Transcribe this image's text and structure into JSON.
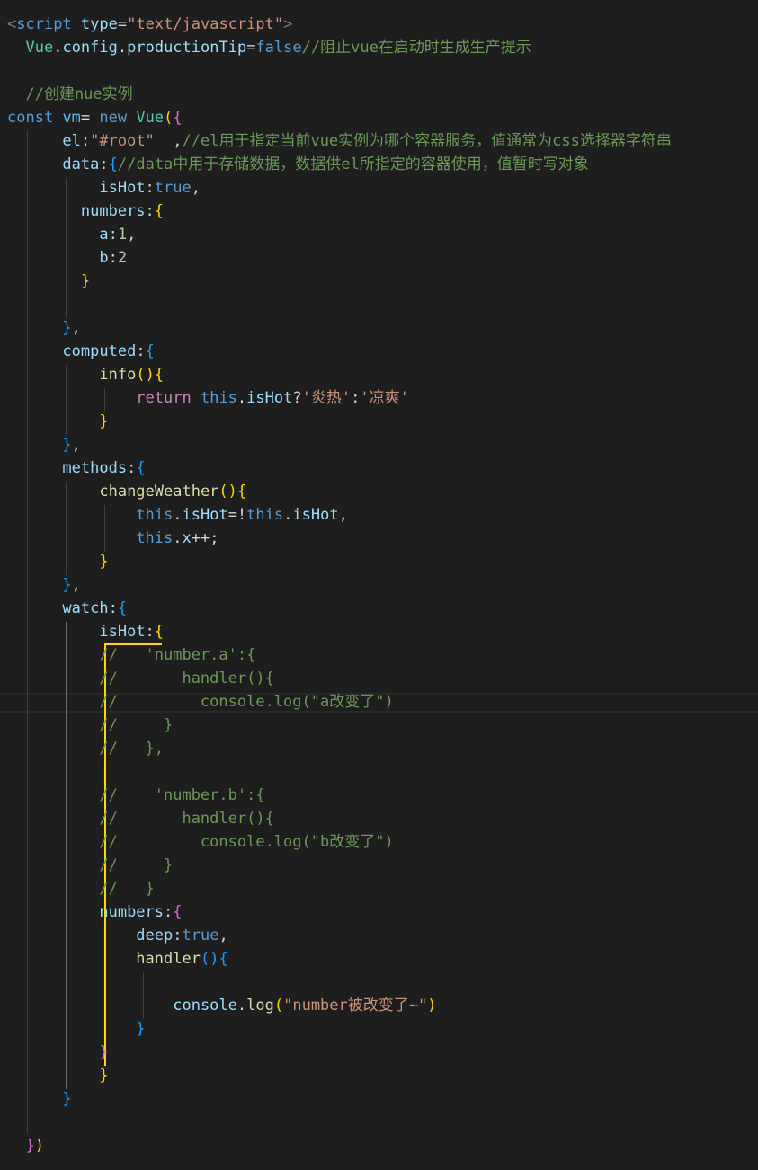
{
  "editor": {
    "language": "html-vue",
    "theme": "dark",
    "background": "#1e1e1e",
    "colors": {
      "default": "#d4d4d4",
      "tag_punct": "#808080",
      "tag": "#569cd6",
      "attr": "#9cdcfe",
      "string": "#ce9178",
      "comment": "#6a9955",
      "keyword": "#569cd6",
      "control": "#c586c0",
      "class": "#4ec9b0",
      "function": "#dcdcaa",
      "variable": "#9cdcfe",
      "const": "#4fc1ff",
      "number": "#b5cea8",
      "bracket1": "#ffd700",
      "bracket2": "#da70d6",
      "bracket3": "#179fff"
    },
    "lines": [
      {
        "tokens": [
          {
            "t": "<",
            "c": "tag_punct"
          },
          {
            "t": "script",
            "c": "tag"
          },
          {
            "t": " ",
            "c": "default"
          },
          {
            "t": "type",
            "c": "attr"
          },
          {
            "t": "=",
            "c": "default"
          },
          {
            "t": "\"text/javascript\"",
            "c": "string"
          },
          {
            "t": ">",
            "c": "tag_punct"
          }
        ]
      },
      {
        "tokens": [
          {
            "t": "  ",
            "c": "default"
          },
          {
            "t": "Vue",
            "c": "class"
          },
          {
            "t": ".",
            "c": "default"
          },
          {
            "t": "config",
            "c": "variable"
          },
          {
            "t": ".",
            "c": "default"
          },
          {
            "t": "productionTip",
            "c": "variable"
          },
          {
            "t": "=",
            "c": "default"
          },
          {
            "t": "false",
            "c": "keyword"
          },
          {
            "t": "//阻止vue在启动时生成生产提示",
            "c": "comment"
          }
        ]
      },
      {
        "tokens": []
      },
      {
        "tokens": [
          {
            "t": "  //创建nue实例",
            "c": "comment"
          }
        ]
      },
      {
        "tokens": [
          {
            "t": "const",
            "c": "keyword"
          },
          {
            "t": " ",
            "c": "default"
          },
          {
            "t": "vm",
            "c": "const"
          },
          {
            "t": "= ",
            "c": "default"
          },
          {
            "t": "new",
            "c": "keyword"
          },
          {
            "t": " ",
            "c": "default"
          },
          {
            "t": "Vue",
            "c": "class"
          },
          {
            "t": "(",
            "c": "bracket1"
          },
          {
            "t": "{",
            "c": "bracket2"
          }
        ]
      },
      {
        "tokens": [
          {
            "t": "      ",
            "c": "default"
          },
          {
            "t": "el",
            "c": "variable"
          },
          {
            "t": ":",
            "c": "default"
          },
          {
            "t": "\"#root\"",
            "c": "string"
          },
          {
            "t": "  ,",
            "c": "default"
          },
          {
            "t": "//el用于指定当前vue实例为哪个容器服务，值通常为css选择器字符串",
            "c": "comment"
          }
        ]
      },
      {
        "tokens": [
          {
            "t": "      ",
            "c": "default"
          },
          {
            "t": "data",
            "c": "variable"
          },
          {
            "t": ":",
            "c": "default"
          },
          {
            "t": "{",
            "c": "bracket3"
          },
          {
            "t": "//data中用于存储数据，数据供el所指定的容器使用，值暂时写对象",
            "c": "comment"
          }
        ]
      },
      {
        "tokens": [
          {
            "t": "          ",
            "c": "default"
          },
          {
            "t": "isHot",
            "c": "variable"
          },
          {
            "t": ":",
            "c": "default"
          },
          {
            "t": "true",
            "c": "keyword"
          },
          {
            "t": ",",
            "c": "default"
          }
        ]
      },
      {
        "tokens": [
          {
            "t": "        ",
            "c": "default"
          },
          {
            "t": "numbers",
            "c": "variable"
          },
          {
            "t": ":",
            "c": "default"
          },
          {
            "t": "{",
            "c": "bracket1"
          }
        ]
      },
      {
        "tokens": [
          {
            "t": "          ",
            "c": "default"
          },
          {
            "t": "a",
            "c": "variable"
          },
          {
            "t": ":",
            "c": "default"
          },
          {
            "t": "1",
            "c": "number"
          },
          {
            "t": ",",
            "c": "default"
          }
        ]
      },
      {
        "tokens": [
          {
            "t": "          ",
            "c": "default"
          },
          {
            "t": "b",
            "c": "variable"
          },
          {
            "t": ":",
            "c": "default"
          },
          {
            "t": "2",
            "c": "number"
          }
        ]
      },
      {
        "tokens": [
          {
            "t": "        ",
            "c": "default"
          },
          {
            "t": "}",
            "c": "bracket1"
          }
        ]
      },
      {
        "tokens": []
      },
      {
        "tokens": [
          {
            "t": "      ",
            "c": "default"
          },
          {
            "t": "}",
            "c": "bracket3"
          },
          {
            "t": ",",
            "c": "default"
          }
        ]
      },
      {
        "tokens": [
          {
            "t": "      ",
            "c": "default"
          },
          {
            "t": "computed",
            "c": "variable"
          },
          {
            "t": ":",
            "c": "default"
          },
          {
            "t": "{",
            "c": "bracket3"
          }
        ]
      },
      {
        "tokens": [
          {
            "t": "          ",
            "c": "default"
          },
          {
            "t": "info",
            "c": "function"
          },
          {
            "t": "(",
            "c": "bracket1"
          },
          {
            "t": ")",
            "c": "bracket1"
          },
          {
            "t": "{",
            "c": "bracket1"
          }
        ]
      },
      {
        "tokens": [
          {
            "t": "              ",
            "c": "default"
          },
          {
            "t": "return",
            "c": "control"
          },
          {
            "t": " ",
            "c": "default"
          },
          {
            "t": "this",
            "c": "keyword"
          },
          {
            "t": ".",
            "c": "default"
          },
          {
            "t": "isHot",
            "c": "variable"
          },
          {
            "t": "?",
            "c": "default"
          },
          {
            "t": "'炎热'",
            "c": "string"
          },
          {
            "t": ":",
            "c": "default"
          },
          {
            "t": "'凉爽'",
            "c": "string"
          }
        ]
      },
      {
        "tokens": [
          {
            "t": "          ",
            "c": "default"
          },
          {
            "t": "}",
            "c": "bracket1"
          }
        ]
      },
      {
        "tokens": [
          {
            "t": "      ",
            "c": "default"
          },
          {
            "t": "}",
            "c": "bracket3"
          },
          {
            "t": ",",
            "c": "default"
          }
        ]
      },
      {
        "tokens": [
          {
            "t": "      ",
            "c": "default"
          },
          {
            "t": "methods",
            "c": "variable"
          },
          {
            "t": ":",
            "c": "default"
          },
          {
            "t": "{",
            "c": "bracket3"
          }
        ]
      },
      {
        "tokens": [
          {
            "t": "          ",
            "c": "default"
          },
          {
            "t": "changeWeather",
            "c": "function"
          },
          {
            "t": "(",
            "c": "bracket1"
          },
          {
            "t": ")",
            "c": "bracket1"
          },
          {
            "t": "{",
            "c": "bracket1"
          }
        ]
      },
      {
        "tokens": [
          {
            "t": "              ",
            "c": "default"
          },
          {
            "t": "this",
            "c": "keyword"
          },
          {
            "t": ".",
            "c": "default"
          },
          {
            "t": "isHot",
            "c": "variable"
          },
          {
            "t": "=!",
            "c": "default"
          },
          {
            "t": "this",
            "c": "keyword"
          },
          {
            "t": ".",
            "c": "default"
          },
          {
            "t": "isHot",
            "c": "variable"
          },
          {
            "t": ",",
            "c": "default"
          }
        ]
      },
      {
        "tokens": [
          {
            "t": "              ",
            "c": "default"
          },
          {
            "t": "this",
            "c": "keyword"
          },
          {
            "t": ".",
            "c": "default"
          },
          {
            "t": "x",
            "c": "variable"
          },
          {
            "t": "++;",
            "c": "default"
          }
        ]
      },
      {
        "tokens": [
          {
            "t": "          ",
            "c": "default"
          },
          {
            "t": "}",
            "c": "bracket1"
          }
        ]
      },
      {
        "tokens": [
          {
            "t": "      ",
            "c": "default"
          },
          {
            "t": "}",
            "c": "bracket3"
          },
          {
            "t": ",",
            "c": "default"
          }
        ]
      },
      {
        "tokens": [
          {
            "t": "      ",
            "c": "default"
          },
          {
            "t": "watch",
            "c": "variable"
          },
          {
            "t": ":",
            "c": "default"
          },
          {
            "t": "{",
            "c": "bracket3"
          }
        ]
      },
      {
        "tokens": [
          {
            "t": "          ",
            "c": "default"
          },
          {
            "t": "isHot",
            "c": "variable"
          },
          {
            "t": ":",
            "c": "default"
          },
          {
            "t": "{",
            "c": "bracket1"
          }
        ]
      },
      {
        "tokens": [
          {
            "t": "          //   'number.a':{",
            "c": "comment"
          }
        ]
      },
      {
        "tokens": [
          {
            "t": "          //       handler(){",
            "c": "comment"
          }
        ]
      },
      {
        "tokens": [
          {
            "t": "          //         console.log(\"a改变了\")",
            "c": "comment"
          }
        ]
      },
      {
        "tokens": [
          {
            "t": "          //     }",
            "c": "comment"
          }
        ]
      },
      {
        "tokens": [
          {
            "t": "          //   },",
            "c": "comment"
          }
        ]
      },
      {
        "tokens": []
      },
      {
        "tokens": [
          {
            "t": "          //    'number.b':{",
            "c": "comment"
          }
        ]
      },
      {
        "tokens": [
          {
            "t": "          //       handler(){",
            "c": "comment"
          }
        ]
      },
      {
        "tokens": [
          {
            "t": "          //         console.log(\"b改变了\")",
            "c": "comment"
          }
        ]
      },
      {
        "tokens": [
          {
            "t": "          //     }",
            "c": "comment"
          }
        ]
      },
      {
        "tokens": [
          {
            "t": "          //   }",
            "c": "comment"
          }
        ]
      },
      {
        "tokens": [
          {
            "t": "          ",
            "c": "default"
          },
          {
            "t": "numbers",
            "c": "variable"
          },
          {
            "t": ":",
            "c": "default"
          },
          {
            "t": "{",
            "c": "bracket2"
          }
        ]
      },
      {
        "tokens": [
          {
            "t": "              ",
            "c": "default"
          },
          {
            "t": "deep",
            "c": "variable"
          },
          {
            "t": ":",
            "c": "default"
          },
          {
            "t": "true",
            "c": "keyword"
          },
          {
            "t": ",",
            "c": "default"
          }
        ]
      },
      {
        "tokens": [
          {
            "t": "              ",
            "c": "default"
          },
          {
            "t": "handler",
            "c": "function"
          },
          {
            "t": "(",
            "c": "bracket3"
          },
          {
            "t": ")",
            "c": "bracket3"
          },
          {
            "t": "{",
            "c": "bracket3"
          }
        ]
      },
      {
        "tokens": []
      },
      {
        "tokens": [
          {
            "t": "                  ",
            "c": "default"
          },
          {
            "t": "console",
            "c": "variable"
          },
          {
            "t": ".",
            "c": "default"
          },
          {
            "t": "log",
            "c": "function"
          },
          {
            "t": "(",
            "c": "bracket1"
          },
          {
            "t": "\"number被改变了~\"",
            "c": "string"
          },
          {
            "t": ")",
            "c": "bracket1"
          }
        ]
      },
      {
        "tokens": [
          {
            "t": "              ",
            "c": "default"
          },
          {
            "t": "}",
            "c": "bracket3"
          }
        ]
      },
      {
        "tokens": [
          {
            "t": "          ",
            "c": "default"
          },
          {
            "t": "}",
            "c": "bracket2"
          }
        ]
      },
      {
        "tokens": [
          {
            "t": "          ",
            "c": "default"
          },
          {
            "t": "}",
            "c": "bracket1"
          }
        ]
      },
      {
        "tokens": [
          {
            "t": "      ",
            "c": "default"
          },
          {
            "t": "}",
            "c": "bracket3"
          }
        ]
      },
      {
        "tokens": []
      },
      {
        "tokens": [
          {
            "t": "  ",
            "c": "default"
          },
          {
            "t": "}",
            "c": "bracket2"
          },
          {
            "t": ")",
            "c": "bracket1"
          }
        ]
      }
    ]
  }
}
